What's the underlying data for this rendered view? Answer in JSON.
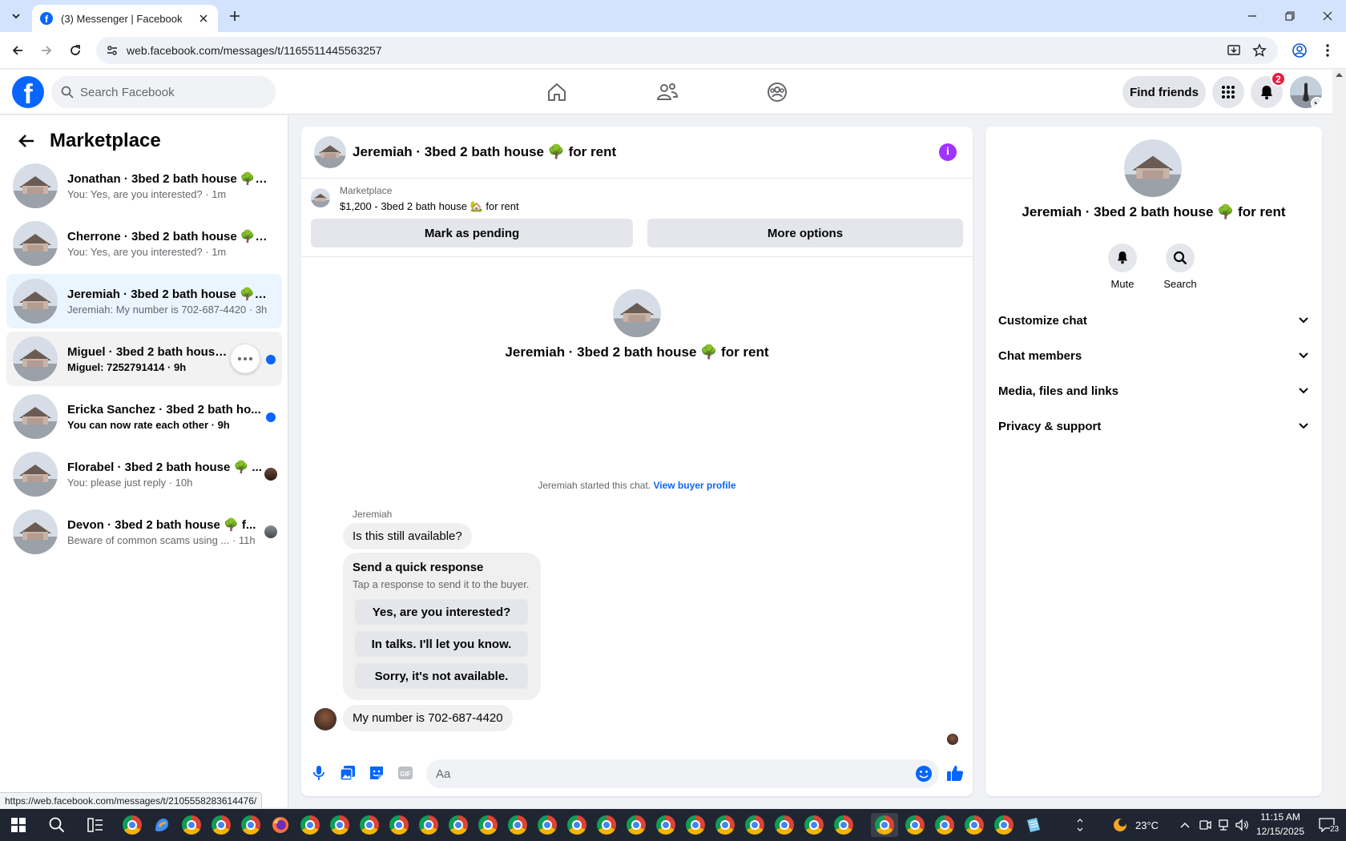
{
  "browser": {
    "tab_title": "(3) Messenger | Facebook",
    "url": "web.facebook.com/messages/t/1165511445563257",
    "status_url": "https://web.facebook.com/messages/t/2105558283614476/"
  },
  "fb": {
    "search_placeholder": "Search Facebook",
    "find_friends": "Find friends",
    "notification_count": "2"
  },
  "sidebar": {
    "title": "Marketplace",
    "conversations": [
      {
        "name": "Jonathan · 3bed 2 bath house 🌳 f...",
        "preview": "You: Yes, are you interested? · 1m"
      },
      {
        "name": "Cherrone · 3bed 2 bath house 🌳 f...",
        "preview": "You: Yes, are you interested? · 1m"
      },
      {
        "name": "Jeremiah · 3bed 2 bath house 🌳 f...",
        "preview": "Jeremiah: My number is 702-687-4420 · 3h"
      },
      {
        "name": "Miguel · 3bed 2 bath house 🌳 f...",
        "preview": "Miguel: 7252791414 · 9h"
      },
      {
        "name": "Ericka Sanchez · 3bed 2 bath ho...",
        "preview": "You can now rate each other · 9h"
      },
      {
        "name": "Florabel · 3bed 2 bath house 🌳 ...",
        "preview": "You: please just reply · 10h"
      },
      {
        "name": "Devon · 3bed 2 bath house 🌳 f...",
        "preview": "Beware of common scams using ... · 11h"
      }
    ]
  },
  "chat": {
    "title": "Jeremiah · 3bed 2 bath house 🌳 for rent",
    "listing_category": "Marketplace",
    "listing_price": "$1,200 - 3bed 2 bath house 🏡 for rent",
    "mark_pending": "Mark as pending",
    "more_options": "More options",
    "intro_title": "Jeremiah · 3bed 2 bath house 🌳 for rent",
    "started_text": "Jeremiah started this chat.",
    "buyer_profile_link": "View buyer profile",
    "sender_name": "Jeremiah",
    "msg1": "Is this still available?",
    "quick_title": "Send a quick response",
    "quick_subtitle": "Tap a response to send it to the buyer.",
    "quick_options": [
      "Yes, are you interested?",
      "In talks. I'll let you know.",
      "Sorry, it's not available."
    ],
    "msg2": "My number is 702-687-4420",
    "composer_placeholder": "Aa"
  },
  "info": {
    "title": "Jeremiah · 3bed 2 bath house 🌳 for rent",
    "mute": "Mute",
    "search": "Search",
    "sections": [
      "Customize chat",
      "Chat members",
      "Media, files and links",
      "Privacy & support"
    ]
  },
  "taskbar": {
    "temperature": "23°C",
    "time": "11:15 AM",
    "date": "12/15/2025",
    "notif_count": "23"
  }
}
